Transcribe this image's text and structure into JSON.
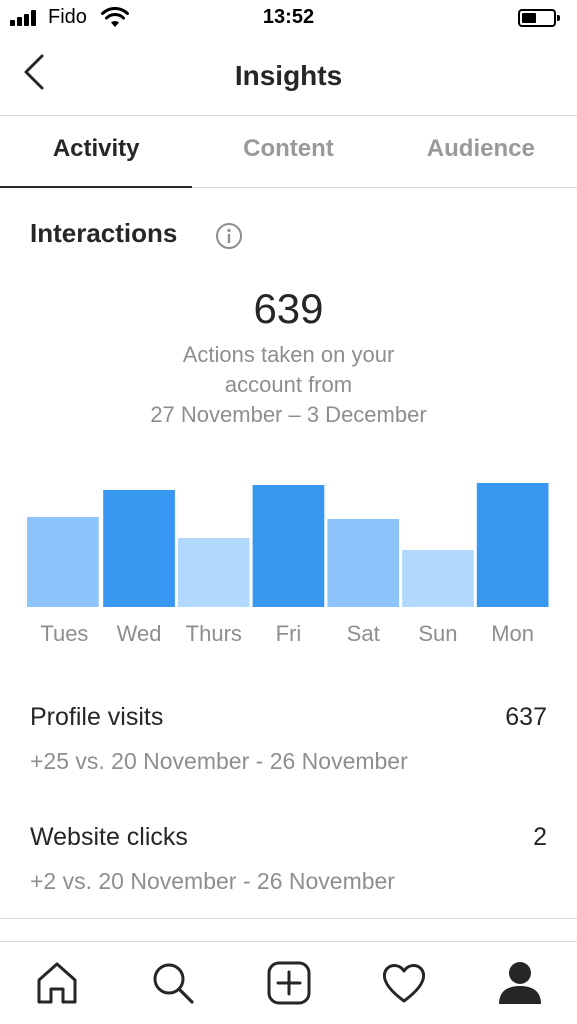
{
  "status_bar": {
    "carrier": "Fido",
    "time": "13:52",
    "battery_level": 0.45
  },
  "header": {
    "title": "Insights",
    "back_icon": "chevron-left-icon"
  },
  "tabs": [
    {
      "label": "Activity",
      "active": true
    },
    {
      "label": "Content",
      "active": false
    },
    {
      "label": "Audience",
      "active": false
    }
  ],
  "interactions": {
    "title": "Interactions",
    "info_icon": "info-icon",
    "total": "639",
    "subtitle_line1": "Actions taken on your",
    "subtitle_line2": "account from",
    "subtitle_line3": "27 November – 3 December"
  },
  "chart_data": {
    "type": "bar",
    "categories": [
      "Tues",
      "Wed",
      "Thurs",
      "Fri",
      "Sat",
      "Sun",
      "Mon"
    ],
    "values": [
      90,
      117,
      69,
      122,
      88,
      57,
      124
    ],
    "ylim": [
      0,
      130
    ],
    "grid": false,
    "colors": [
      "#8cc4fb",
      "#3897f0",
      "#b3d8fd",
      "#3897f0",
      "#8cc4fb",
      "#b3d8fd",
      "#3897f0"
    ]
  },
  "stats": {
    "profile_visits": {
      "label": "Profile visits",
      "value": "637",
      "compare": "+25 vs. 20 November - 26 November"
    },
    "website_clicks": {
      "label": "Website clicks",
      "value": "2",
      "compare": "+2 vs. 20 November - 26 November"
    }
  },
  "bottom_nav": {
    "items": [
      "home-icon",
      "search-icon",
      "new-post-icon",
      "activity-heart-icon",
      "profile-icon"
    ]
  }
}
